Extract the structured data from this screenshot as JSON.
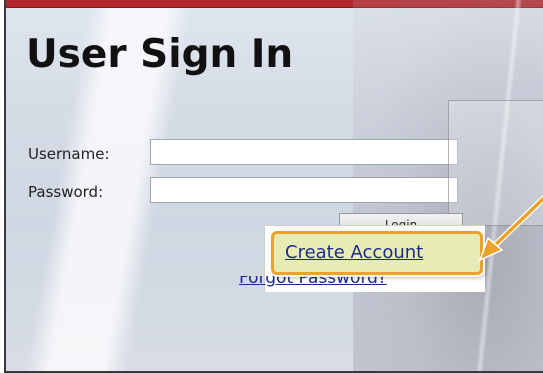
{
  "page": {
    "title": "User Sign In"
  },
  "form": {
    "username_label": "Username:",
    "username_value": "",
    "password_label": "Password:",
    "password_value": "",
    "login_button_label": "Login"
  },
  "links": {
    "create_account": "Create Account",
    "forgot_password": "Forgot Password?"
  },
  "annotation": {
    "highlight_target": "Create Account",
    "arrow_color": "#e9a32b",
    "highlight_fill": "#e7ecb4"
  },
  "colors": {
    "top_bar": "#b3262b",
    "link": "#1c2b8a",
    "title": "#111111"
  }
}
